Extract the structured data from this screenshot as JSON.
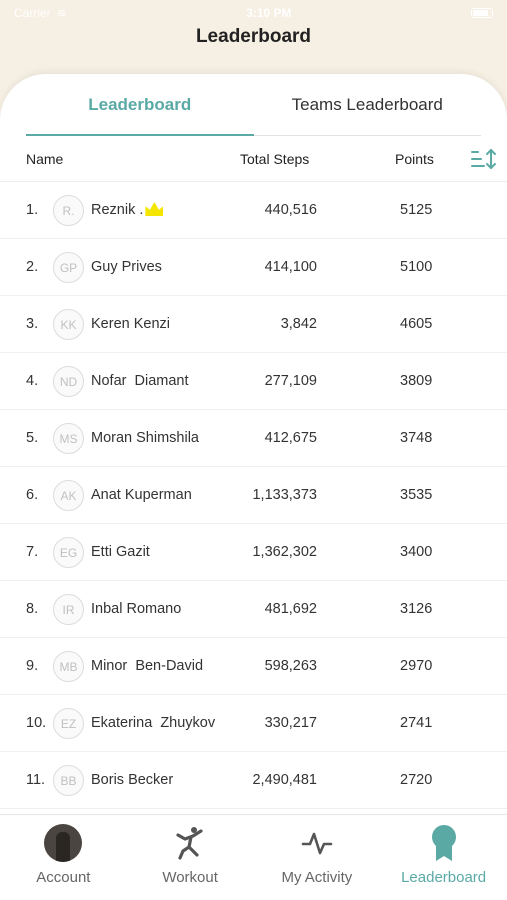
{
  "status_bar": {
    "carrier": "Carrier",
    "time": "3:10 PM"
  },
  "header": {
    "title": "Leaderboard"
  },
  "tabs": [
    {
      "label": "Leaderboard",
      "active": true
    },
    {
      "label": "Teams Leaderboard",
      "active": false
    }
  ],
  "columns": {
    "name": "Name",
    "steps": "Total Steps",
    "points": "Points"
  },
  "rows": [
    {
      "rank": "1.",
      "initials": "R.",
      "name": "Reznik .",
      "steps": "440,516",
      "points": "5125",
      "crown": true
    },
    {
      "rank": "2.",
      "initials": "GP",
      "name": "Guy Prives",
      "steps": "414,100",
      "points": "5100"
    },
    {
      "rank": "3.",
      "initials": "KK",
      "name": "Keren Kenzi",
      "steps": "3,842",
      "points": "4605"
    },
    {
      "rank": "4.",
      "initials": "ND",
      "name": "Nofar  Diamant",
      "steps": "277,109",
      "points": "3809"
    },
    {
      "rank": "5.",
      "initials": "MS",
      "name": "Moran Shimshila",
      "steps": "412,675",
      "points": "3748"
    },
    {
      "rank": "6.",
      "initials": "AK",
      "name": "Anat Kuperman",
      "steps": "1,133,373",
      "points": "3535"
    },
    {
      "rank": "7.",
      "initials": "EG",
      "name": "Etti Gazit",
      "steps": "1,362,302",
      "points": "3400"
    },
    {
      "rank": "8.",
      "initials": "IR",
      "name": "Inbal Romano",
      "steps": "481,692",
      "points": "3126"
    },
    {
      "rank": "9.",
      "initials": "MB",
      "name": "Minor  Ben-David",
      "steps": "598,263",
      "points": "2970"
    },
    {
      "rank": "10.",
      "initials": "EZ",
      "name": "Ekaterina  Zhuykov",
      "steps": "330,217",
      "points": "2741"
    },
    {
      "rank": "11.",
      "initials": "BB",
      "name": "Boris Becker",
      "steps": "2,490,481",
      "points": "2720"
    }
  ],
  "tabbar": [
    {
      "label": "Account",
      "icon": "account-avatar"
    },
    {
      "label": "Workout",
      "icon": "workout-figure-icon"
    },
    {
      "label": "My Activity",
      "icon": "activity-pulse-icon"
    },
    {
      "label": "Leaderboard",
      "icon": "award-badge-icon",
      "active": true
    }
  ],
  "colors": {
    "accent": "#5aa9a5",
    "background": "#f6efe3",
    "crown": "#f5e600"
  }
}
